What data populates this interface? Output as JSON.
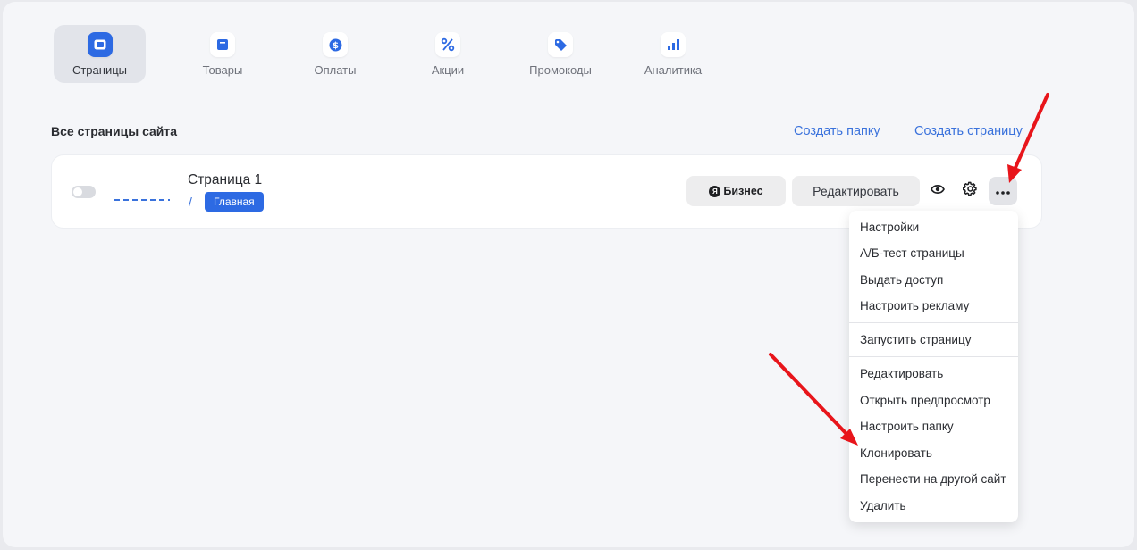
{
  "tabs": [
    {
      "label": "Страницы",
      "icon": "pages-icon"
    },
    {
      "label": "Товары",
      "icon": "products-icon"
    },
    {
      "label": "Оплаты",
      "icon": "payments-icon"
    },
    {
      "label": "Акции",
      "icon": "percent-icon"
    },
    {
      "label": "Промокоды",
      "icon": "tag-icon"
    },
    {
      "label": "Аналитика",
      "icon": "analytics-icon"
    }
  ],
  "section": {
    "title": "Все страницы сайта",
    "create_folder": "Создать папку",
    "create_page": "Создать страницу"
  },
  "page_row": {
    "name": "Страница 1",
    "path": "/",
    "badge": "Главная",
    "business_label": "Бизнес",
    "business_logo": "Я",
    "edit_label": "Редактировать"
  },
  "menu": {
    "items": [
      "Настройки",
      "А/Б-тест страницы",
      "Выдать доступ",
      "Настроить рекламу",
      "Запустить страницу",
      "Редактировать",
      "Открыть предпросмотр",
      "Настроить папку",
      "Клонировать",
      "Перенести на другой сайт",
      "Удалить"
    ]
  },
  "colors": {
    "accent": "#2d6ae3",
    "link": "#3a72dc",
    "annotation_arrow": "#e8151b"
  }
}
